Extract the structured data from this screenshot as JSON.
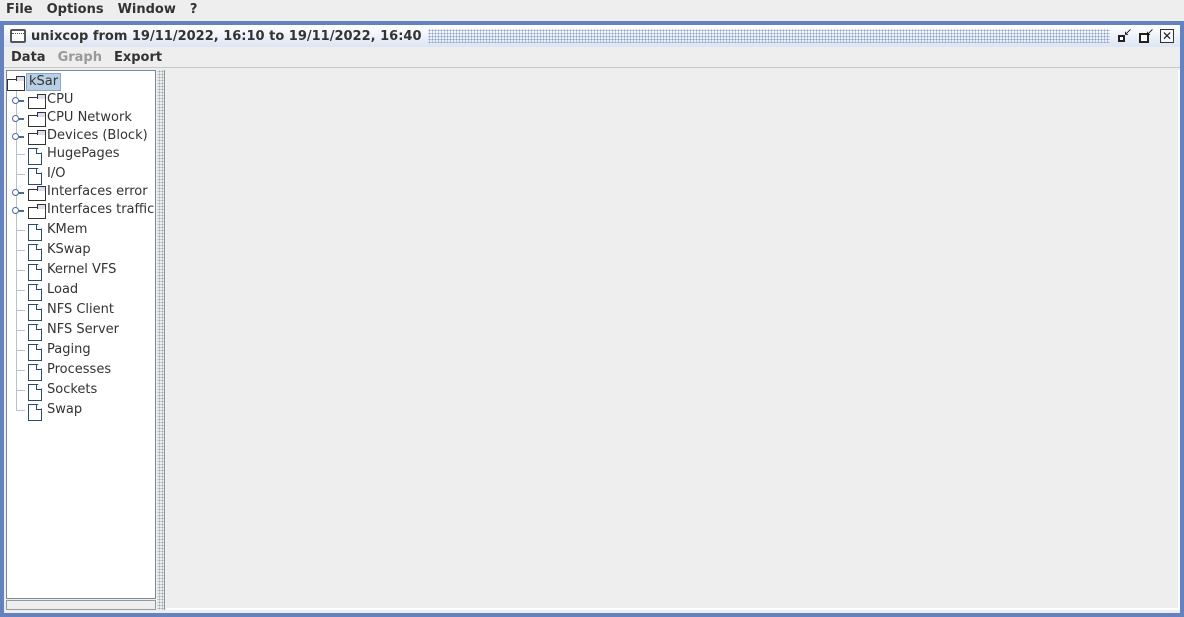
{
  "menubar": {
    "items": [
      "File",
      "Options",
      "Window",
      "?"
    ]
  },
  "window": {
    "title": "unixcop from 19/11/2022, 16:10 to 19/11/2022, 16:40",
    "buttons": {
      "iconify": "iconify",
      "maximize": "maximize",
      "close": "close"
    }
  },
  "inner_menubar": {
    "items": [
      {
        "label": "Data",
        "enabled": true
      },
      {
        "label": "Graph",
        "enabled": false
      },
      {
        "label": "Export",
        "enabled": true
      }
    ]
  },
  "tree": {
    "root": "kSar",
    "items": [
      {
        "label": "CPU",
        "type": "folder",
        "expandable": true
      },
      {
        "label": "CPU Network",
        "type": "folder",
        "expandable": true
      },
      {
        "label": "Devices (Block)",
        "type": "folder",
        "expandable": true
      },
      {
        "label": "HugePages",
        "type": "leaf",
        "expandable": false
      },
      {
        "label": "I/O",
        "type": "leaf",
        "expandable": false
      },
      {
        "label": "Interfaces error",
        "type": "folder",
        "expandable": true
      },
      {
        "label": "Interfaces traffic",
        "type": "folder",
        "expandable": true
      },
      {
        "label": "KMem",
        "type": "leaf",
        "expandable": false
      },
      {
        "label": "KSwap",
        "type": "leaf",
        "expandable": false
      },
      {
        "label": "Kernel VFS",
        "type": "leaf",
        "expandable": false
      },
      {
        "label": "Load",
        "type": "leaf",
        "expandable": false
      },
      {
        "label": "NFS Client",
        "type": "leaf",
        "expandable": false
      },
      {
        "label": "NFS Server",
        "type": "leaf",
        "expandable": false
      },
      {
        "label": "Paging",
        "type": "leaf",
        "expandable": false
      },
      {
        "label": "Processes",
        "type": "leaf",
        "expandable": false
      },
      {
        "label": "Sockets",
        "type": "leaf",
        "expandable": false
      },
      {
        "label": "Swap",
        "type": "leaf",
        "expandable": false
      }
    ]
  },
  "colors": {
    "frame_border": "#6382bf",
    "selection": "#b8cfe5",
    "disabled_text": "#999999"
  }
}
